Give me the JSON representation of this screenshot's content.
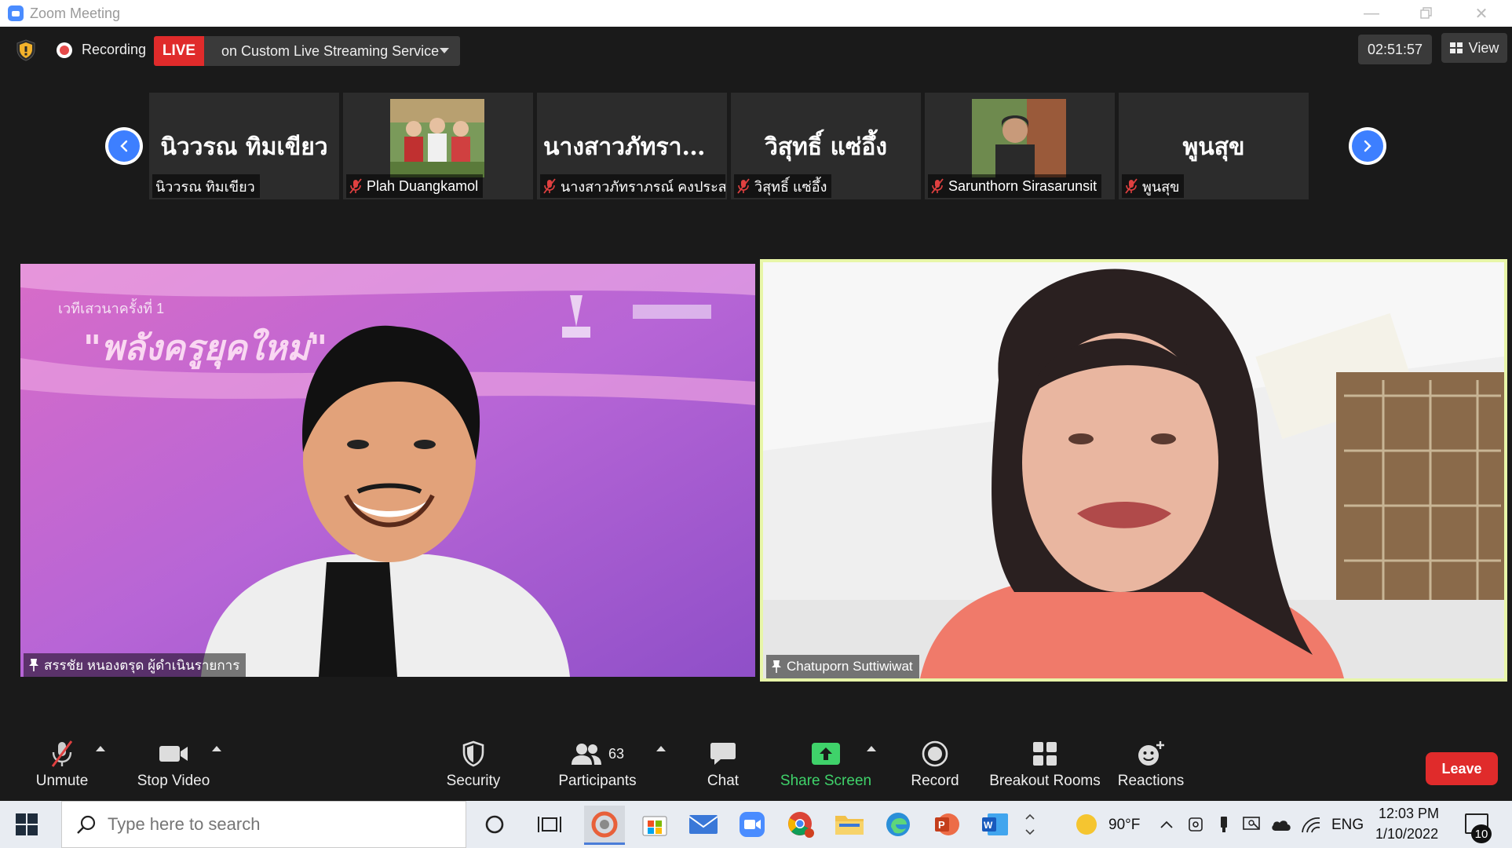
{
  "window": {
    "title": "Zoom Meeting"
  },
  "topbar": {
    "recording_label": "Recording",
    "live_badge": "LIVE",
    "live_service": "on Custom Live Streaming Service",
    "timer": "02:51:57",
    "view_label": "View"
  },
  "thumbnails": [
    {
      "big_name": "นิววรณ ทิมเขียว",
      "label": "นิววรณ ทิมเขียว",
      "muted": false
    },
    {
      "big_name": "",
      "label": "Plah Duangkamol",
      "muted": true
    },
    {
      "big_name": "นางสาวภัทราภร...",
      "label": "นางสาวภัทราภรณ์ คงประสม",
      "muted": true
    },
    {
      "big_name": "วิสุทธิ์ แซ่อึ้ง",
      "label": "วิสุทธิ์ แซ่อึ้ง",
      "muted": true
    },
    {
      "big_name": "",
      "label": "Sarunthorn Sirasarunsit",
      "muted": true
    },
    {
      "big_name": "พูนสุข",
      "label": "พูนสุข",
      "muted": true
    }
  ],
  "main_videos": {
    "left": {
      "label": "สรรชัย หนองตรุด ผู้ดำเนินรายการ",
      "banner_line1": "เวทีเสวนาครั้งที่ 1",
      "banner_line2": "\"พลังครูยุคใหม่\""
    },
    "right": {
      "label": "Chatuporn Suttiwiwat"
    }
  },
  "toolbar": {
    "unmute": "Unmute",
    "stop_video": "Stop Video",
    "security": "Security",
    "participants": "Participants",
    "participants_count": "63",
    "chat": "Chat",
    "share_screen": "Share Screen",
    "record": "Record",
    "breakout_rooms": "Breakout Rooms",
    "reactions": "Reactions",
    "leave": "Leave"
  },
  "taskbar": {
    "search_placeholder": "Type here to search",
    "weather": "90°F",
    "language": "ENG",
    "time": "12:03 PM",
    "date": "1/10/2022",
    "notification_count": "10"
  },
  "colors": {
    "live_red": "#e02b2b",
    "share_green": "#3fd26a",
    "nav_blue": "#3d7fff",
    "active_speaker_border": "#e8f6a8"
  }
}
